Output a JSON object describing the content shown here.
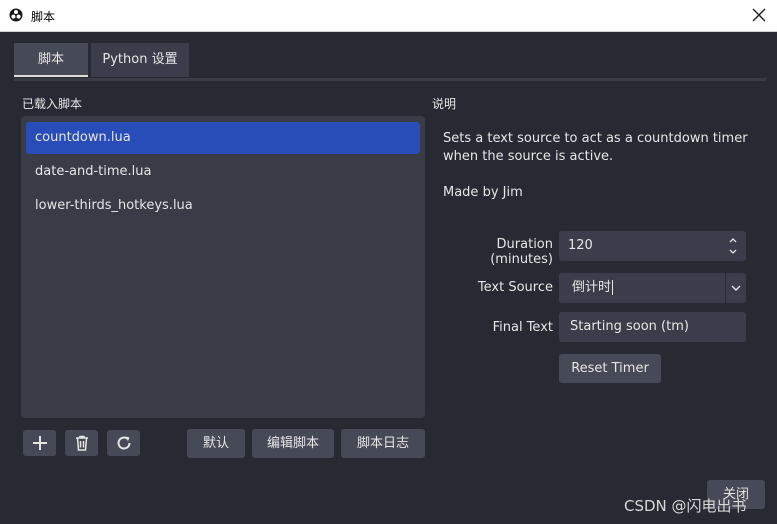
{
  "window": {
    "title": "脚本",
    "close_icon": "close-icon"
  },
  "tabs": [
    {
      "label": "脚本"
    },
    {
      "label": "Python 设置"
    }
  ],
  "left": {
    "header": "已载入脚本",
    "scripts": [
      "countdown.lua",
      "date-and-time.lua",
      "lower-thirds_hotkeys.lua"
    ],
    "selected_index": 0,
    "toolbar": {
      "add_icon": "plus-icon",
      "remove_icon": "trash-icon",
      "reload_icon": "reload-icon",
      "defaults_label": "默认",
      "edit_label": "编辑脚本",
      "log_label": "脚本日志"
    }
  },
  "right": {
    "header": "说明",
    "description_line1": "Sets a text source to act as a countdown timer",
    "description_line2": "when the source is active.",
    "author": "Made by Jim",
    "properties": {
      "duration_label": "Duration (minutes)",
      "duration_value": "120",
      "text_source_label": "Text Source",
      "text_source_value": "倒计时",
      "final_text_label": "Final Text",
      "final_text_value": "Starting soon (tm)",
      "reset_button": "Reset Timer"
    }
  },
  "footer": {
    "close_label": "关闭"
  },
  "watermark": "CSDN @闪电出书",
  "colors": {
    "selection": "#284cb8",
    "background": "#272a33",
    "panel": "#393c47"
  }
}
